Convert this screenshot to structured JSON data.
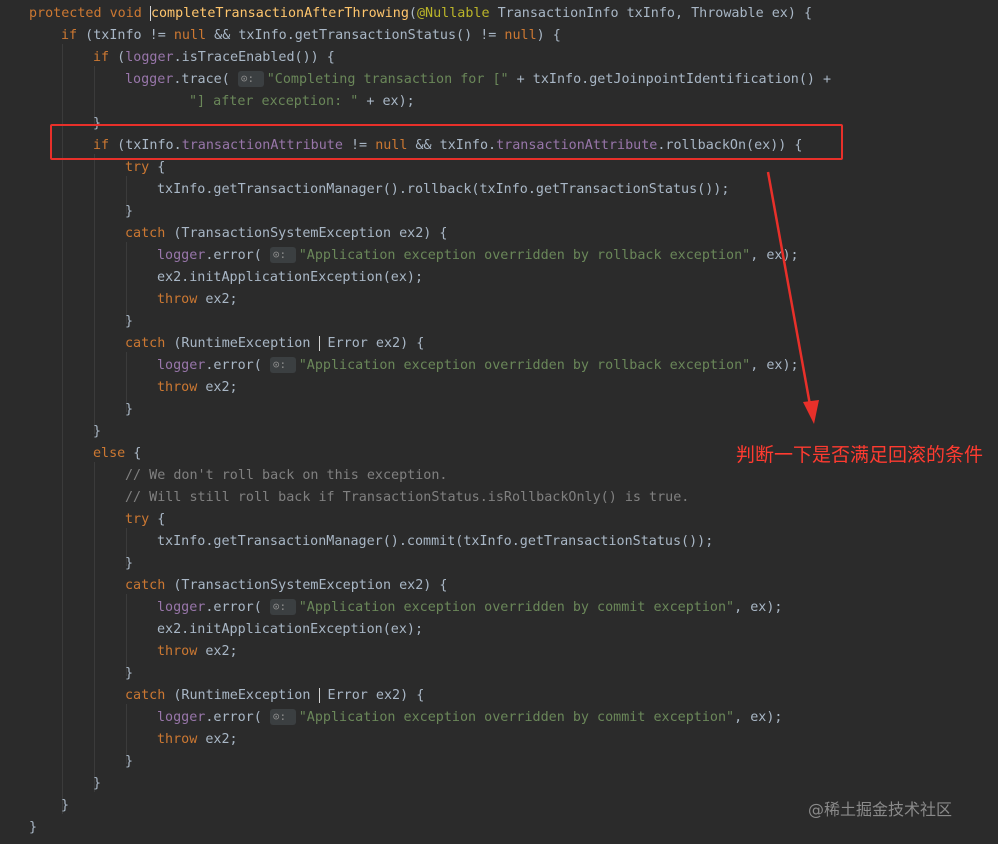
{
  "code_editor": {
    "lines": [
      "protected void |completeTransactionAfterThrowing(@Nullable TransactionInfo txInfo, Throwable ex) {",
      "if (txInfo != null && txInfo.getTransactionStatus() != null) {",
      "if (logger.isTraceEnabled()) {",
      "logger.trace( msg: \"Completing transaction for [\" + txInfo.getJoinpointIdentification() +",
      "\"] after exception: \" + ex);",
      "}",
      "if (txInfo.transactionAttribute != null && txInfo.transactionAttribute.rollbackOn(ex)) {",
      "try {",
      "txInfo.getTransactionManager().rollback(txInfo.getTransactionStatus());",
      "}",
      "catch (TransactionSystemException ex2) {",
      "logger.error( msg: \"Application exception overridden by rollback exception\", ex);",
      "ex2.initApplicationException(ex);",
      "throw ex2;",
      "}",
      "catch (RuntimeException | Error ex2) {",
      "logger.error( msg: \"Application exception overridden by rollback exception\", ex);",
      "throw ex2;",
      "}",
      "}",
      "else {",
      "// We don't roll back on this exception.",
      "// Will still roll back if TransactionStatus.isRollbackOnly() is true.",
      "try {",
      "txInfo.getTransactionManager().commit(txInfo.getTransactionStatus());",
      "}",
      "catch (TransactionSystemException ex2) {",
      "logger.error( msg: \"Application exception overridden by commit exception\", ex);",
      "ex2.initApplicationException(ex);",
      "throw ex2;",
      "}",
      "catch (RuntimeException | Error ex2) {",
      "logger.error( msg: \"Application exception overridden by commit exception\", ex);",
      "throw ex2;",
      "}",
      "}",
      "}",
      "}"
    ],
    "param_hint_icon": "tag-icon"
  },
  "annotation": {
    "text": "判断一下是否满足回滚的条件",
    "color": "#ff3b30"
  },
  "watermark": "@稀土掘金技术社区"
}
